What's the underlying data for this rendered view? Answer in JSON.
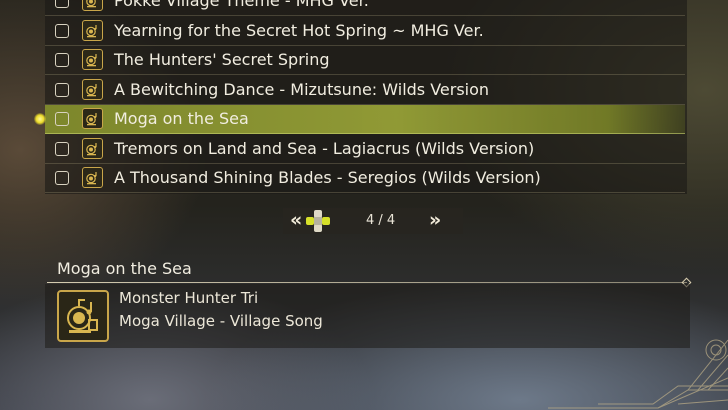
{
  "songs": [
    {
      "title": "Pokke Village Theme - MHG Ver.",
      "checked": false,
      "selected": false
    },
    {
      "title": "Yearning for the Secret Hot Spring ~ MHG Ver.",
      "checked": false,
      "selected": false
    },
    {
      "title": "The Hunters' Secret Spring",
      "checked": false,
      "selected": false
    },
    {
      "title": "A Bewitching Dance - Mizutsune: Wilds Version",
      "checked": false,
      "selected": false
    },
    {
      "title": "Moga on the Sea",
      "checked": false,
      "selected": true
    },
    {
      "title": "Tremors on Land and Sea - Lagiacrus (Wilds Version)",
      "checked": false,
      "selected": false
    },
    {
      "title": "A Thousand Shining Blades - Seregios (Wilds Version)",
      "checked": false,
      "selected": false
    }
  ],
  "pager": {
    "page": "4 / 4",
    "prev": "«",
    "next": "»"
  },
  "details": {
    "title": "Moga on the Sea",
    "game": "Monster Hunter Tri",
    "track": "Moga Village - Village Song"
  },
  "icons": {
    "song": "music-player-icon",
    "cursor": "selection-cursor-icon"
  },
  "colors": {
    "highlight": "#8f9a33",
    "icon_border": "#c9a64a",
    "cursor": "#ecdc2a"
  }
}
